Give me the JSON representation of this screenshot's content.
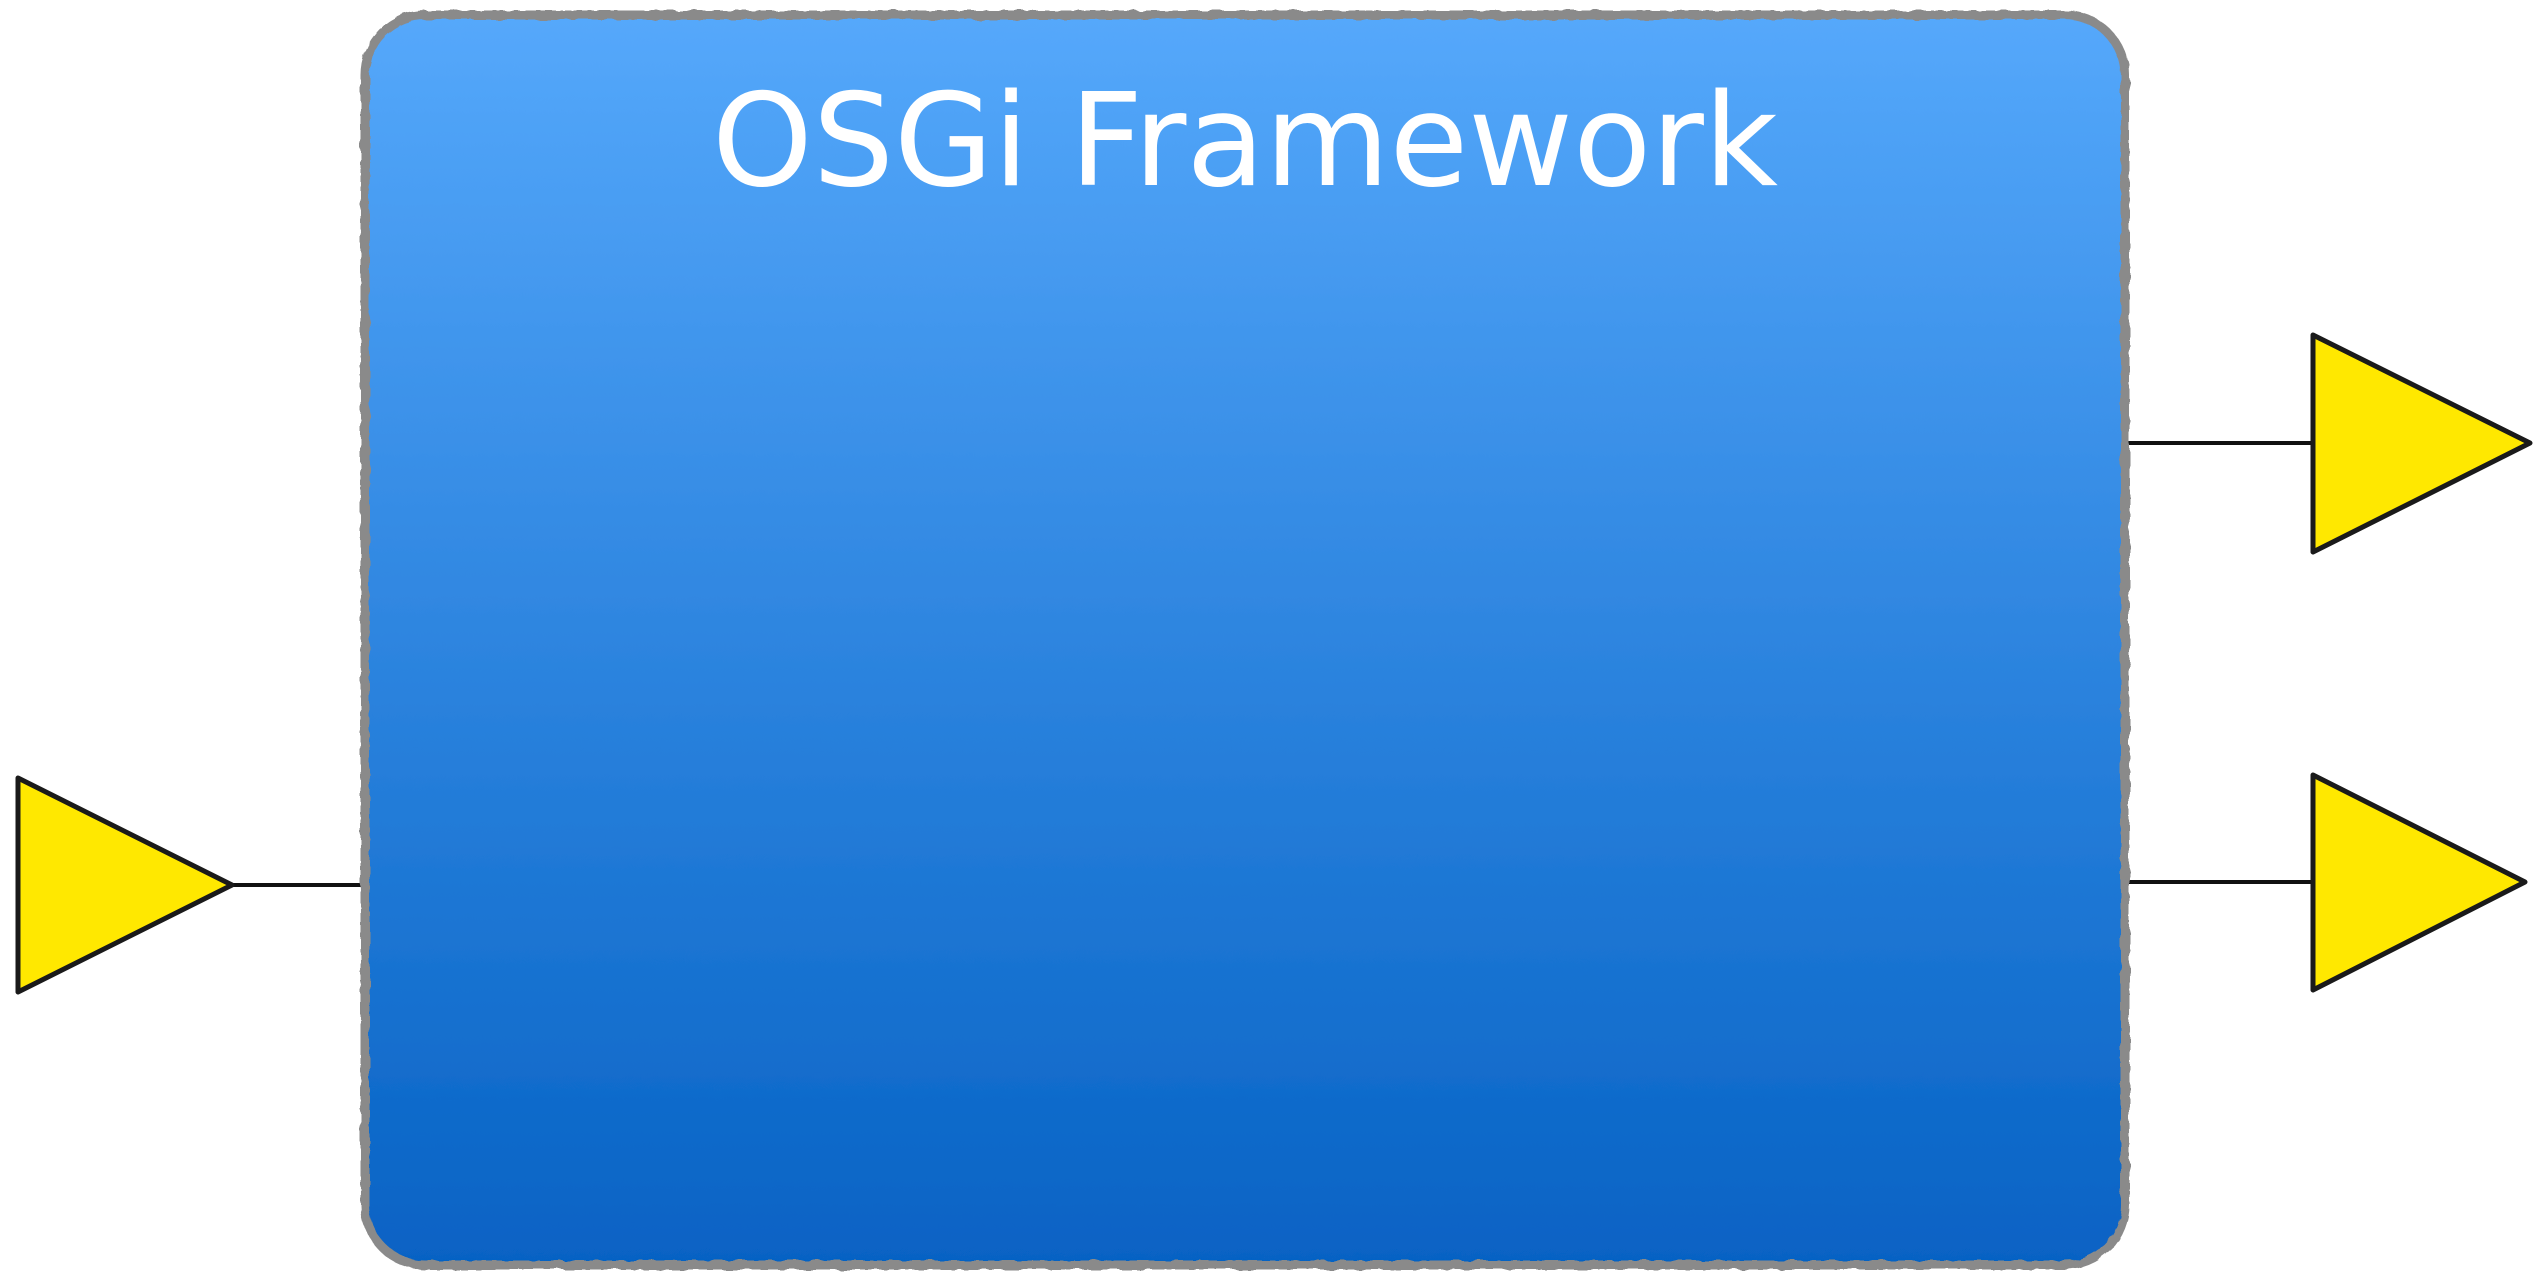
{
  "diagram": {
    "title": "OSGi Framework",
    "colors": {
      "box_top": "#55a8fb",
      "box_bottom": "#0662c4",
      "box_border": "#8a8a8a",
      "triangle_fill": "#ffe800",
      "triangle_stroke": "#1a1a1a",
      "connector": "#111111",
      "title_text": "#ffffff"
    },
    "shapes": {
      "box": "rounded-rectangle",
      "ports": "triangle",
      "connectors": "line"
    }
  }
}
